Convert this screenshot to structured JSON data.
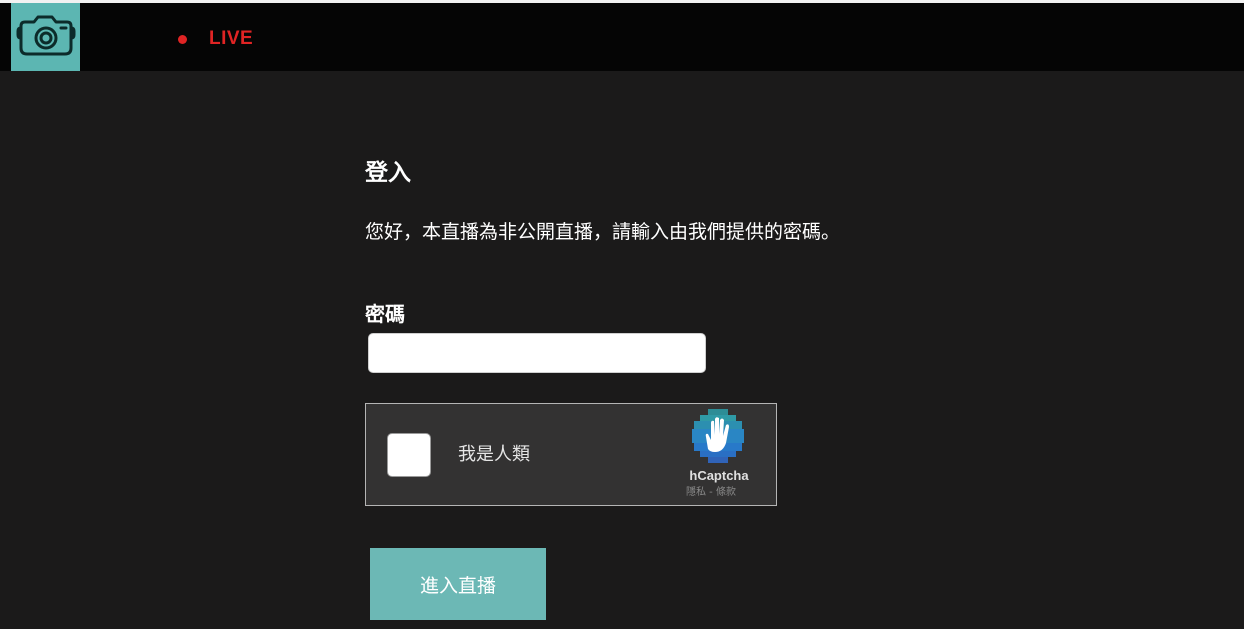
{
  "header": {
    "logo_icon": "camera-icon",
    "live_label": "LIVE",
    "accent_color": "#5cb6b2",
    "live_color": "#e02424"
  },
  "login": {
    "title": "登入",
    "description": "您好，本直播為非公開直播，請輸入由我們提供的密碼。",
    "password_label": "密碼",
    "password_value": "",
    "submit_label": "進入直播"
  },
  "captcha": {
    "checkbox_label": "我是人類",
    "brand": "hCaptcha",
    "links": "隱私 - 條款",
    "logo_icon": "hcaptcha-hand-icon"
  }
}
